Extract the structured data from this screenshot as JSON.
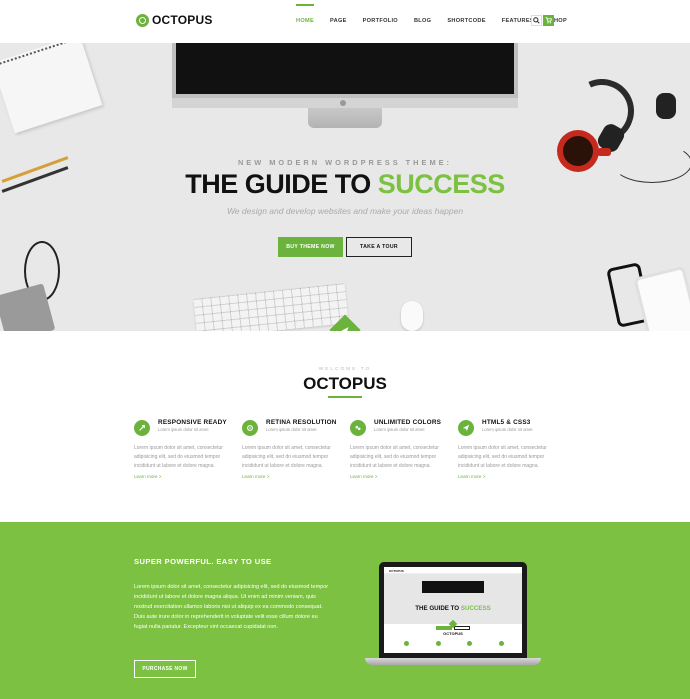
{
  "header": {
    "logo_text": "OCTOPUS",
    "nav": [
      {
        "label": "HOME",
        "active": true
      },
      {
        "label": "PAGE",
        "active": false
      },
      {
        "label": "PORTFOLIO",
        "active": false
      },
      {
        "label": "BLOG",
        "active": false
      },
      {
        "label": "SHORTCODE",
        "active": false
      },
      {
        "label": "FEATURES",
        "active": false
      },
      {
        "label": "SHOP",
        "active": false
      }
    ],
    "search_icon": "search-icon",
    "cart_icon": "cart-icon"
  },
  "hero": {
    "kicker": "NEW MODERN WORDPRESS THEME:",
    "title_main": "THE GUIDE TO ",
    "title_accent": "SUCCESS",
    "subtitle": "We design and develop websites and make your ideas happen",
    "buy_label": "BUY THEME NOW",
    "tour_label": "TAKE A TOUR"
  },
  "welcome": {
    "kicker": "WELCOME TO",
    "title": "OCTOPUS"
  },
  "features": [
    {
      "icon": "rocket-icon",
      "title": "RESPONSIVE READY",
      "small": "Lorem ipsum dolor sit amet",
      "text": "Lorem ipsum dolor sit amet, consectetur adipisicing elit, sed do eiusmod tempor incididunt ut labore et dolore magna.",
      "more": "Learn more >"
    },
    {
      "icon": "eye-icon",
      "title": "RETINA RESOLUTION",
      "small": "Lorem ipsum dolor sit amet",
      "text": "Lorem ipsum dolor sit amet, consectetur adipisicing elit, sed do eiusmod tempor incididunt ut labore et dolore magna.",
      "more": "Learn more >"
    },
    {
      "icon": "palette-icon",
      "title": "UNLIMITED COLORS",
      "small": "Lorem ipsum dolor sit amet",
      "text": "Lorem ipsum dolor sit amet, consectetur adipisicing elit, sed do eiusmod tempor incididunt ut labore et dolore magna.",
      "more": "Learn more >"
    },
    {
      "icon": "paper-plane-icon",
      "title": "HTML5 & CSS3",
      "small": "Lorem ipsum dolor sit amet",
      "text": "Lorem ipsum dolor sit amet, consectetur adipisicing elit, sed do eiusmod tempor incididunt ut labore et dolore magna.",
      "more": "Learn more >"
    }
  ],
  "band": {
    "title": "SUPER POWERFUL. EASY TO USE",
    "text": "Lorem ipsum dolor sit amet, consectetur adipisicing elit, sed do eiusmod tempor incididunt ut labore et dolore magna aliqua. Ut enim ad minim veniam, quis nostrud exercitation ullamco laboris nisi ut aliquip ex ea commodo consequat. Duis aute irure dolor in reprehenderit in voluptate velit esse cillum dolore eu fugiat nulla pariatur. Excepteur sint occaecat cupidatat non.",
    "button_label": "PURCHASE NOW",
    "laptop": {
      "logo": "OCTOPUS",
      "title_main": "THE GUIDE TO ",
      "title_accent": "SUCCESS",
      "welcome": "OCTOPUS"
    }
  },
  "colors": {
    "accent": "#6cb33e",
    "accent_light": "#7cc142",
    "hero_bg": "#e8e8e8"
  }
}
